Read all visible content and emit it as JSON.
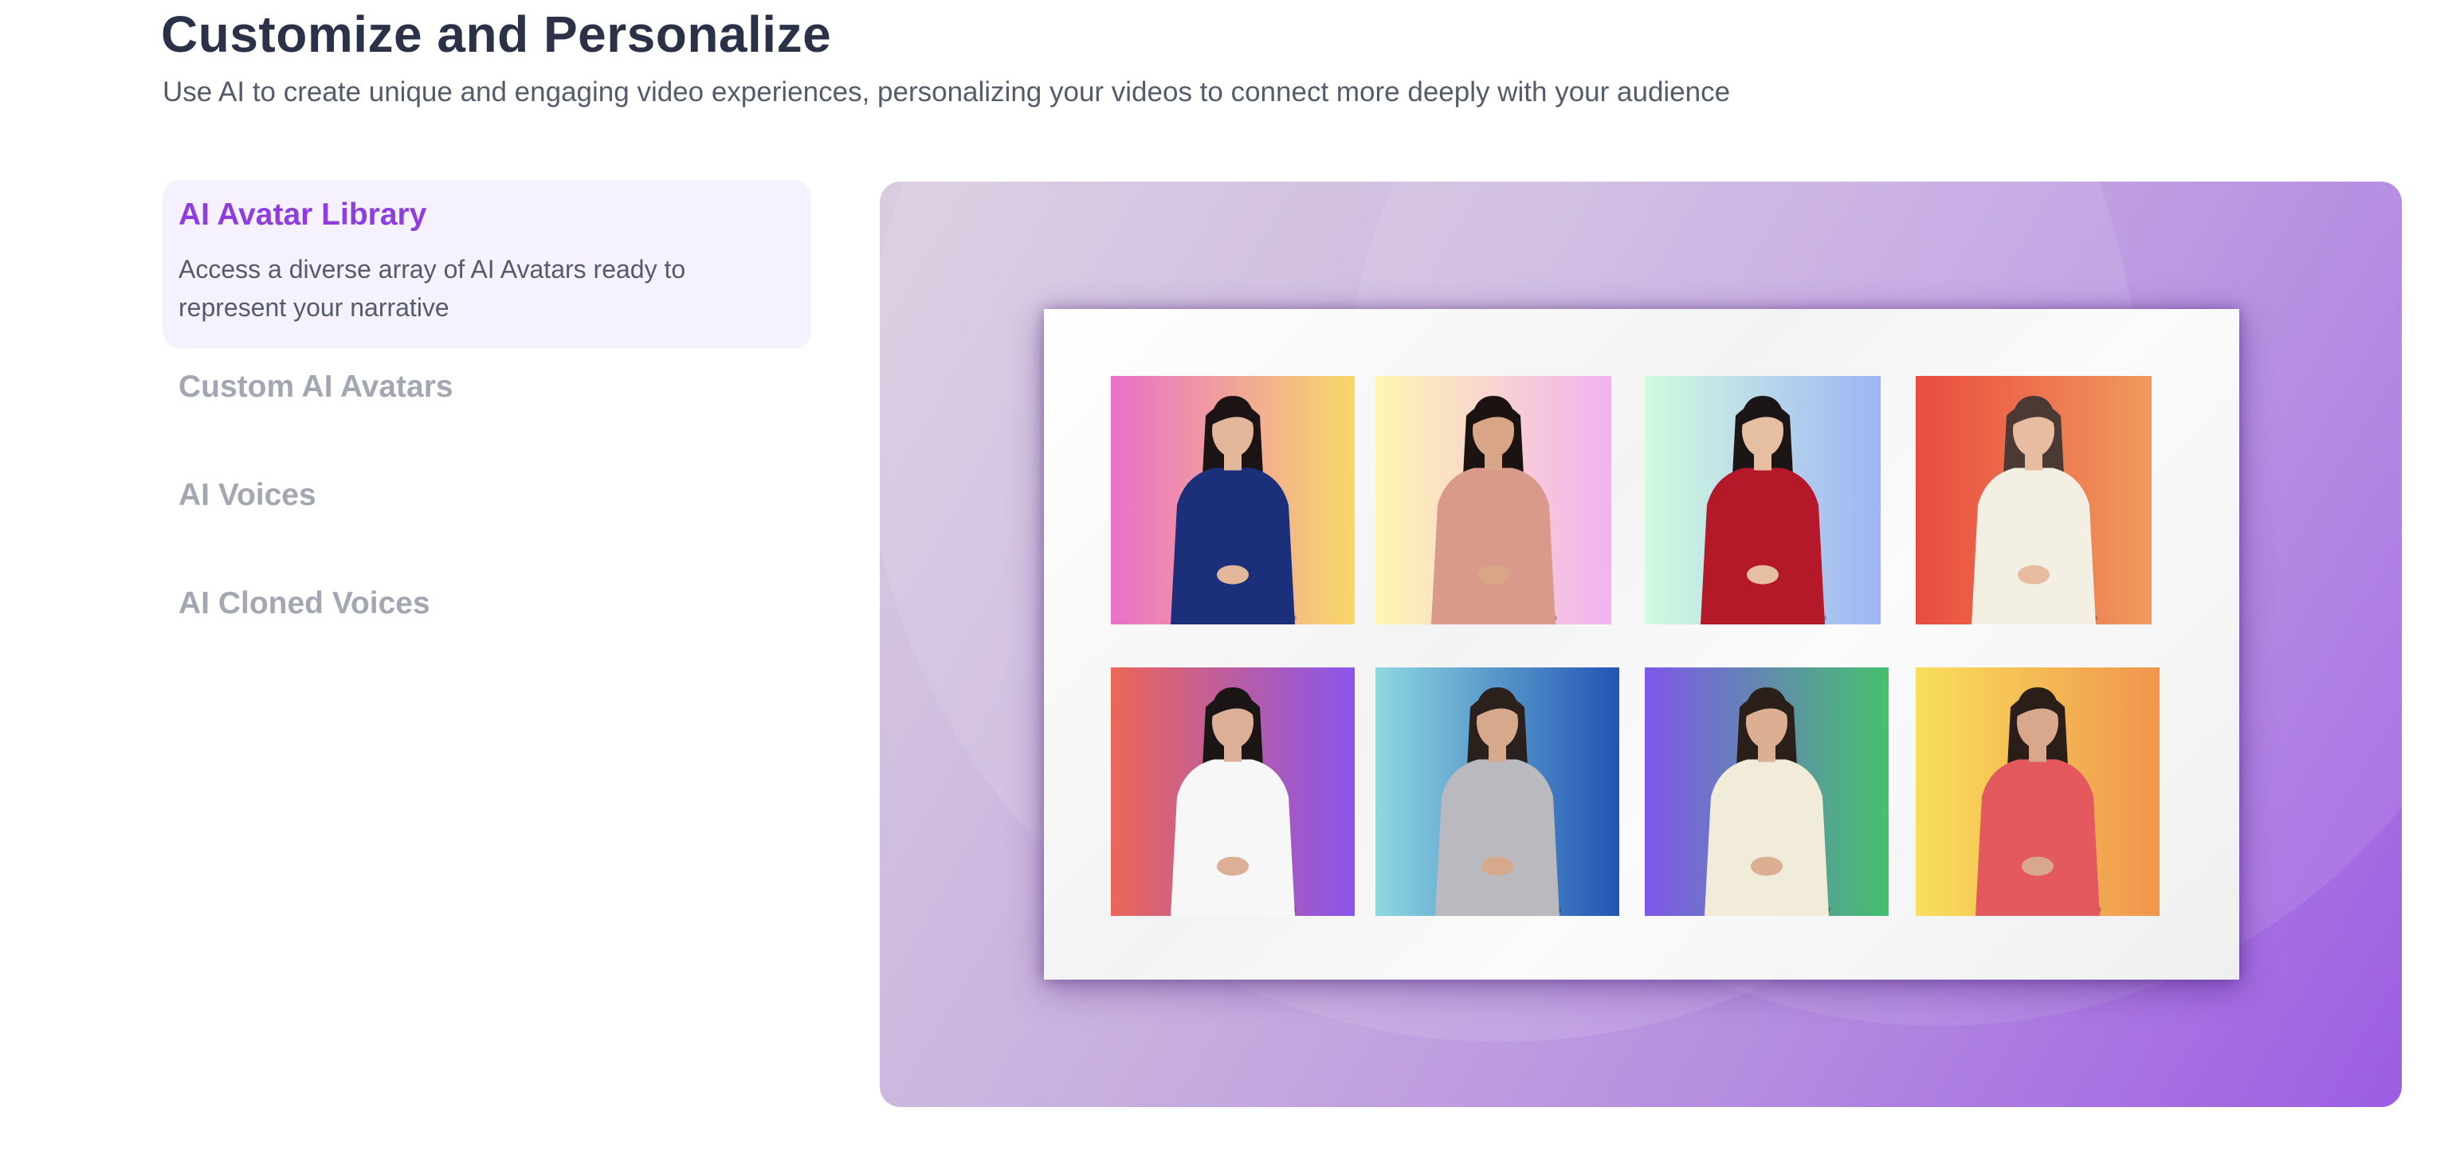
{
  "header": {
    "title": "Customize and Personalize",
    "subtitle": "Use AI to create unique and engaging video experiences, personalizing your videos to connect more deeply with your audience"
  },
  "tabs": [
    {
      "label": "AI Avatar Library",
      "description": "Access a diverse array of AI Avatars ready to represent your narrative",
      "active": true
    },
    {
      "label": "Custom AI Avatars",
      "active": false
    },
    {
      "label": "AI Voices",
      "active": false
    },
    {
      "label": "AI Cloned Voices",
      "active": false
    }
  ],
  "colors": {
    "accent": "#8f3ddd",
    "active_tab_bg": "#f6f1fe",
    "inactive_tab": "#a3a7b1",
    "heading": "#2b3247",
    "body_text": "#545b6b",
    "media_gradient_start": "#d8cde0",
    "media_gradient_end": "#9d5de3"
  },
  "avatar_grid": {
    "tiles": [
      {
        "outfit": "#1b2f7a",
        "skin": "#e3b89a",
        "hair": "#1c1414"
      },
      {
        "outfit": "#d99a8c",
        "skin": "#d9a587",
        "hair": "#1a1311"
      },
      {
        "outfit": "#b4192a",
        "skin": "#e6bea2",
        "hair": "#1b1515"
      },
      {
        "outfit": "#f4efe3",
        "skin": "#e8bca0",
        "hair": "#4a3a33"
      },
      {
        "outfit": "#f7f7f7",
        "skin": "#dcb096",
        "hair": "#1b1515"
      },
      {
        "outfit": "#b9b9bf",
        "skin": "#d6a98c",
        "hair": "#2a211d"
      },
      {
        "outfit": "#f1ebd9",
        "skin": "#dcae92",
        "hair": "#2a1f1a"
      },
      {
        "outfit": "#e4595d",
        "skin": "#d9a88c",
        "hair": "#2b1e18"
      }
    ]
  }
}
